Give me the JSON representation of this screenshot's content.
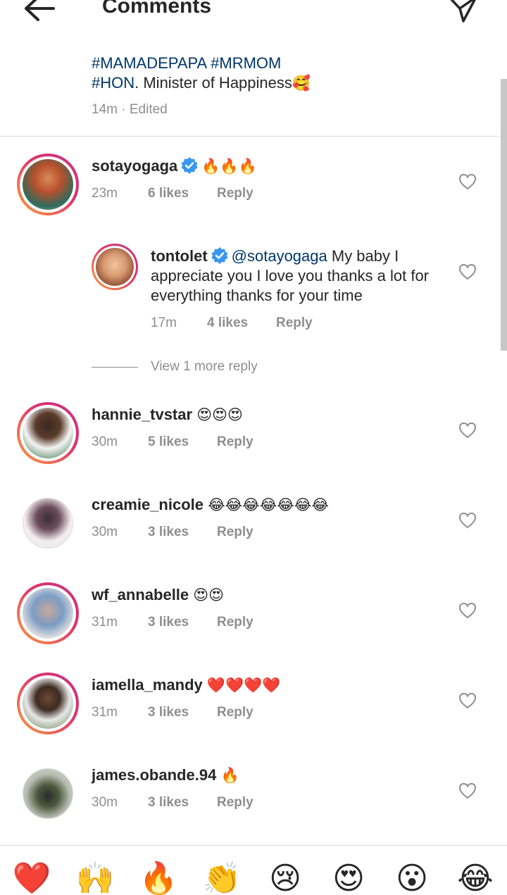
{
  "header": {
    "title": "Comments"
  },
  "post": {
    "hashtag1": "#MAMADEPAPA",
    "hashtag2": "#MRMOM",
    "hashtag3": "#HON",
    "caption_text": ". Minister of Happiness",
    "caption_emoji": "🥰",
    "time": "14m",
    "edited": " · Edited"
  },
  "comments": [
    {
      "username": "sotayogaga",
      "verified": true,
      "text": "🔥🔥🔥",
      "time": "23m",
      "likes": "6 likes",
      "reply": "Reply"
    },
    {
      "username": "tontolet",
      "verified": true,
      "mention": "@sotayogaga",
      "text": " My baby I appreciate you I love you thanks a lot for everything thanks for your time",
      "time": "17m",
      "likes": "4 likes",
      "reply": "Reply"
    },
    {
      "username": "hannie_tvstar",
      "text": "😍😍😍",
      "time": "30m",
      "likes": "5 likes",
      "reply": "Reply"
    },
    {
      "username": "creamie_nicole",
      "text": "😂😂😂😂😂😂😂",
      "time": "30m",
      "likes": "3 likes",
      "reply": "Reply"
    },
    {
      "username": "wf_annabelle",
      "text": "😍😍",
      "time": "31m",
      "likes": "3 likes",
      "reply": "Reply"
    },
    {
      "username": "iamella_mandy",
      "text": "❤️❤️❤️❤️",
      "time": "31m",
      "likes": "3 likes",
      "reply": "Reply"
    },
    {
      "username": "james.obande.94",
      "text": "🔥",
      "time": "30m",
      "likes": "3 likes",
      "reply": "Reply"
    }
  ],
  "view_more": "View 1 more reply",
  "reactions": [
    "❤️",
    "🙌",
    "🔥",
    "👏",
    "😢",
    "😍",
    "😮",
    "😂"
  ],
  "colors": {
    "link": "#00376b",
    "muted": "#8e8e8e",
    "verified": "#3897f0",
    "text": "#262626"
  }
}
